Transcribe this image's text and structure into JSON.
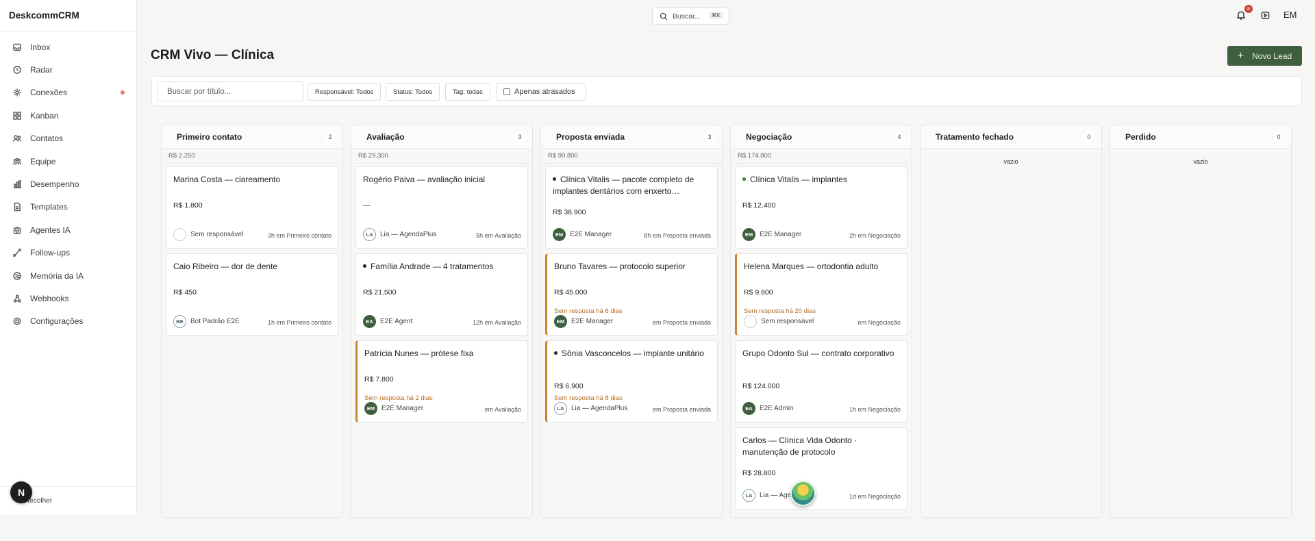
{
  "app": {
    "brand": "DeskcommCRM"
  },
  "sidebar": {
    "items": [
      {
        "label": "Inbox",
        "icon": "inbox-icon"
      },
      {
        "label": "Radar",
        "icon": "clock-icon"
      },
      {
        "label": "Conexões",
        "icon": "plug-icon",
        "has_dot": true
      },
      {
        "label": "Kanban",
        "icon": "kanban-icon"
      },
      {
        "label": "Contatos",
        "icon": "contacts-icon"
      },
      {
        "label": "Equipe",
        "icon": "team-icon"
      },
      {
        "label": "Desempenho",
        "icon": "chart-icon"
      },
      {
        "label": "Templates",
        "icon": "document-icon"
      },
      {
        "label": "Agentes IA",
        "icon": "bot-icon"
      },
      {
        "label": "Follow-ups",
        "icon": "route-icon"
      },
      {
        "label": "Memória da IA",
        "icon": "brain-icon"
      },
      {
        "label": "Webhooks",
        "icon": "webhook-icon"
      },
      {
        "label": "Configurações",
        "icon": "gear-icon"
      }
    ],
    "collapse_label": "Recolher",
    "assistant_badge": "N"
  },
  "topbar": {
    "search_placeholder": "Buscar...",
    "search_shortcut": "⌘K",
    "notifications_count": "8",
    "user_initials": "EM"
  },
  "page": {
    "title": "CRM Vivo — Clínica",
    "new_lead_label": "Novo Lead"
  },
  "filters": {
    "title_placeholder": "Buscar por título...",
    "responsavel": "Responsável: Todos",
    "status": "Status: Todos",
    "tag": "Tag: todas",
    "overdue_label": "Apenas atrasados"
  },
  "empty_label": "vazio",
  "columns": [
    {
      "title": "Primeiro contato",
      "count": "2",
      "total": "R$ 2.250",
      "cards": [
        {
          "title": "Marina Costa — clareamento",
          "value": "R$ 1.800",
          "owner": "Sem responsável",
          "avatar": "",
          "avatar_style": "empty",
          "time": "3h em Primeiro contato"
        },
        {
          "title": "Caio Ribeiro — dor de dente",
          "value": "R$ 450",
          "owner": "Bot Padrão E2E",
          "avatar": "BE",
          "avatar_style": "outline",
          "time": "1h em Primeiro contato"
        }
      ]
    },
    {
      "title": "Avaliação",
      "count": "3",
      "total": "R$ 29.300",
      "cards": [
        {
          "title": "Rogério Paiva — avaliação inicial",
          "value": "—",
          "owner": "Lia — AgendaPlus",
          "avatar": "LA",
          "avatar_style": "outline",
          "time": "5h em Avaliação"
        },
        {
          "title": "Família Andrade — 4 tratamentos",
          "dot": "dark",
          "value": "R$ 21.500",
          "owner": "E2E Agent",
          "avatar": "EA",
          "avatar_style": "green",
          "time": "12h em Avaliação"
        },
        {
          "title": "Patrícia Nunes — prótese fixa",
          "late": true,
          "value": "R$ 7.800",
          "warn": "Sem resposta há 2 dias",
          "owner": "E2E Manager",
          "avatar": "EM",
          "avatar_style": "green",
          "time": "em Avaliação"
        }
      ]
    },
    {
      "title": "Proposta enviada",
      "count": "3",
      "total": "R$ 90.800",
      "cards": [
        {
          "title": "Clínica Vitalis — pacote completo de implantes dentários com enxerto…",
          "dot": "dark",
          "two_line": true,
          "value": "R$ 38.900",
          "owner": "E2E Manager",
          "avatar": "EM",
          "avatar_style": "green",
          "time": "8h em Proposta enviada"
        },
        {
          "title": "Bruno Tavares — protocolo superior",
          "late": true,
          "value": "R$ 45.000",
          "warn": "Sem resposta há 6 dias",
          "owner": "E2E Manager",
          "avatar": "EM",
          "avatar_style": "green",
          "time": "em Proposta enviada"
        },
        {
          "title": "Sônia Vasconcelos — implante unitário",
          "dot": "dark",
          "late": true,
          "two_line": true,
          "value": "R$ 6.900",
          "warn": "Sem resposta há 8 dias",
          "owner": "Lia — AgendaPlus",
          "avatar": "LA",
          "avatar_style": "outline",
          "time": "em Proposta enviada"
        }
      ]
    },
    {
      "title": "Negociação",
      "count": "4",
      "total": "R$ 174.800",
      "cards": [
        {
          "title": "Clínica Vitalis — implantes",
          "dot": "green",
          "value": "R$ 12.400",
          "owner": "E2E Manager",
          "avatar": "EM",
          "avatar_style": "green",
          "time": "2h em Negociação"
        },
        {
          "title": "Helena Marques — ortodontia adulto",
          "late": true,
          "value": "R$ 9.600",
          "warn": "Sem resposta há 20 dias",
          "owner": "Sem responsável",
          "avatar": "",
          "avatar_style": "empty",
          "time": "em Negociação"
        },
        {
          "title": "Grupo Odonto Sul — contrato corporativo",
          "two_line": true,
          "value": "R$ 124.000",
          "owner": "E2E Admin",
          "avatar": "EA",
          "avatar_style": "green",
          "time": "1h em Negociação"
        },
        {
          "title": "Carlos — Clínica Vida Odonto · manutenção de protocolo",
          "two_line": true,
          "value": "R$ 28.800",
          "owner": "Lia — AgendaPlus",
          "avatar": "LA",
          "avatar_style": "outline",
          "time": "1d em Negociação"
        }
      ]
    },
    {
      "title": "Tratamento fechado",
      "count": "0",
      "total": "",
      "cards": []
    },
    {
      "title": "Perdido",
      "count": "0",
      "total": "",
      "cards": []
    }
  ],
  "colors": {
    "accent": "#3f5e3d",
    "warn": "#b76a1e",
    "notification": "#c9473a"
  }
}
